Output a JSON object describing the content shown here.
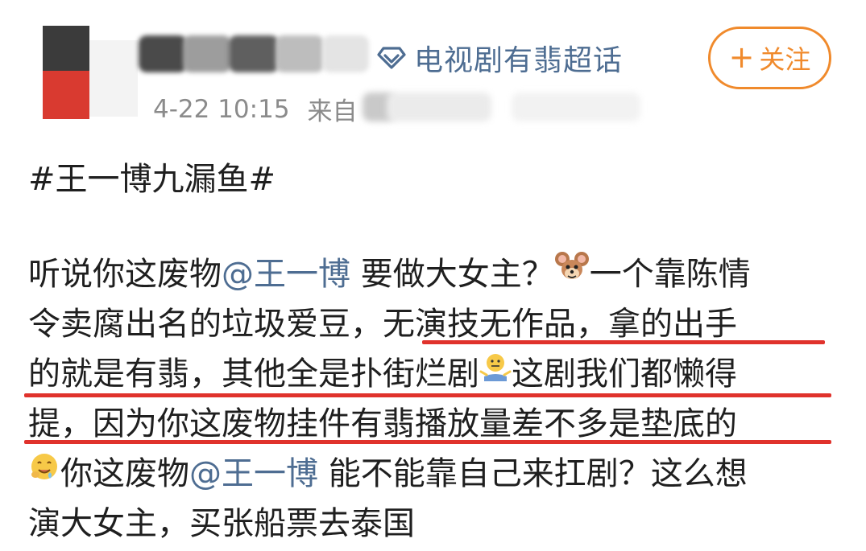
{
  "header": {
    "supertopic_label": "电视剧有翡超话",
    "follow_label": "关注",
    "follow_plus": "+",
    "time": "4-22 10:15",
    "source_prefix": "来自"
  },
  "post": {
    "hashtag": "#王一博九漏鱼#",
    "line1": {
      "a": "听说你这废物",
      "mention": "@王一博",
      "b": " 要做大女主？",
      "emoji": "jerry-mouse-emoji",
      "c": "一个靠陈情"
    },
    "line2": {
      "a": "令卖腐出名的垃圾爱豆，",
      "b": "无演技无作品，拿的出手"
    },
    "line3": {
      "a": "的就是有翡，其他全是扑街烂剧",
      "emoji": "shrug-emoji",
      "b": "这剧我们都懒得"
    },
    "line4": {
      "a": "提，因为你这废物挂件有翡播放量差不多是垫底的"
    },
    "line5": {
      "emoji": "drooling-emoji",
      "a": "你这废物",
      "mention": "@王一博",
      "b": " 能不能靠自己来扛剧？这么想"
    },
    "line6": {
      "a": "演大女主，买张船票去泰国"
    }
  },
  "colors": {
    "mention": "#4e6d92",
    "follow_accent": "#f08a2c",
    "highlight_underline": "#e0322c",
    "meta_gray": "#8b8b8b"
  }
}
